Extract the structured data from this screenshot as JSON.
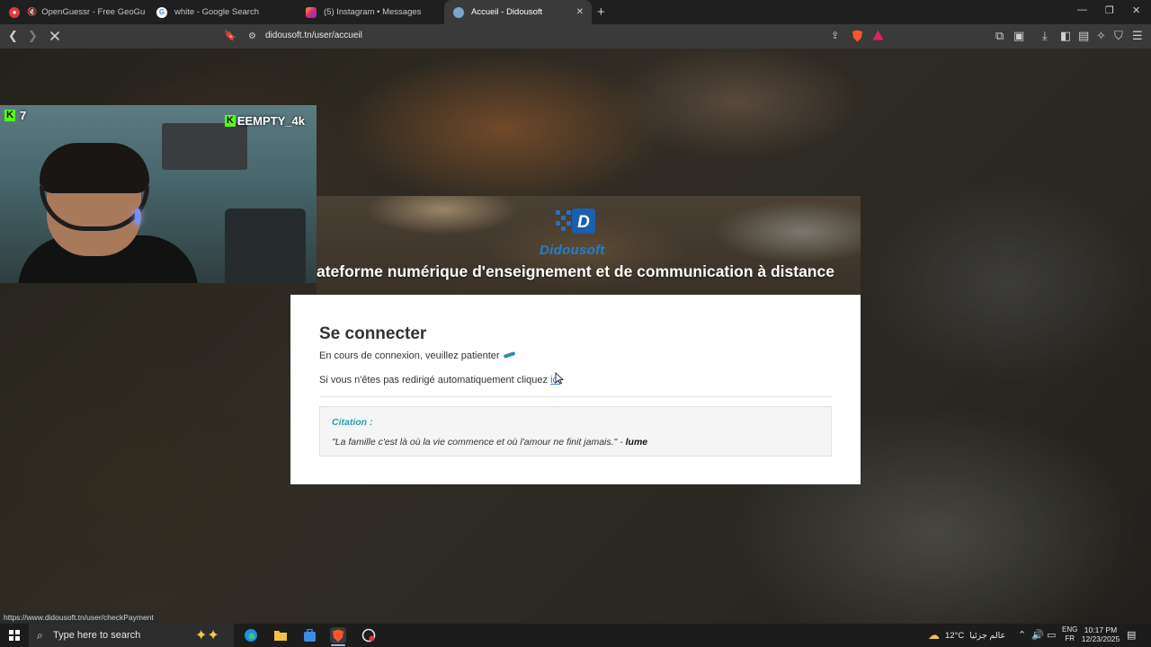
{
  "tabs": [
    {
      "label": "OpenGuessr - Free GeoGuessr Al",
      "icon": "openguessr-icon",
      "muted": true
    },
    {
      "label": "white - Google Search",
      "icon": "google-icon"
    },
    {
      "label": "(5) Instagram • Messages",
      "icon": "instagram-icon"
    },
    {
      "label": "Accueil - Didousoft",
      "icon": "didousoft-icon",
      "active": true
    }
  ],
  "toolbar": {
    "url": "didousoft.tn/user/accueil"
  },
  "webcam": {
    "viewer_count": "7",
    "streamer": "EEMPTY_4k",
    "brand_color": "#53fc18"
  },
  "hero": {
    "brand": "Didousoft",
    "title": "ateforme numérique d'enseignement et de communication à distance"
  },
  "login": {
    "title": "Se connecter",
    "status": "En cours de connexion, veuillez patienter",
    "redirect_text": "Si vous n'êtes pas redirigé automatiquement cliquez",
    "redirect_link": "ici",
    "quote_label": "Citation :",
    "quote_text": "\"La famille c'est là où la vie commence et où l'amour ne finit jamais.\" - ",
    "quote_author": "lume"
  },
  "status_url": "https://www.didousoft.tn/user/checkPayment",
  "taskbar": {
    "search_placeholder": "Type here to search",
    "temperature": "12°C",
    "weather_text": "عالم جزئيا",
    "lang_line1": "ENG",
    "lang_line2": "FR",
    "time": "10:17 PM",
    "date": "12/23/2025"
  },
  "colors": {
    "accent_teal": "#2a9cad",
    "link_blue": "#3a7bb8",
    "brand_blue": "#1f7fd3"
  }
}
